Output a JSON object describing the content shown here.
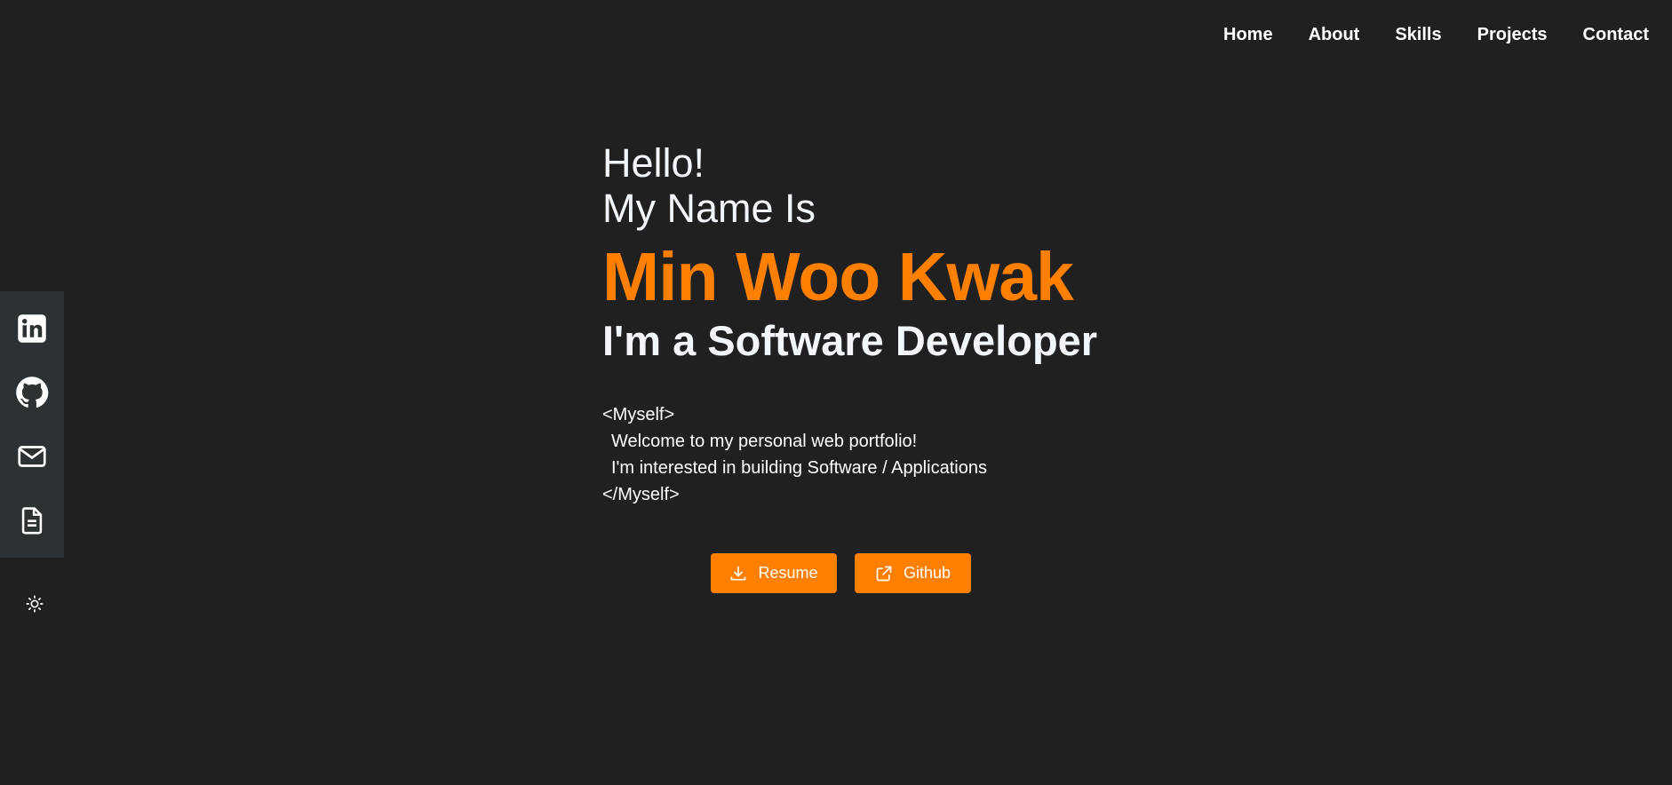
{
  "nav": {
    "items": [
      {
        "label": "Home"
      },
      {
        "label": "About"
      },
      {
        "label": "Skills"
      },
      {
        "label": "Projects"
      },
      {
        "label": "Contact"
      }
    ]
  },
  "social": {
    "icons": [
      "linkedin-icon",
      "github-icon",
      "mail-icon",
      "document-icon"
    ]
  },
  "theme_toggle_icon": "sun-icon",
  "hero": {
    "greeting_line1": "Hello!",
    "greeting_line2": "My Name Is",
    "name": "Min Woo Kwak",
    "role": "I'm a Software Developer",
    "about_open": "<Myself>",
    "about_line1": "Welcome to my personal web portfolio!",
    "about_line2": "I'm interested in building Software / Applications",
    "about_close": "</Myself>"
  },
  "buttons": {
    "resume_label": "Resume",
    "github_label": "Github"
  },
  "colors": {
    "background": "#202020",
    "accent": "#ff7f00",
    "sidebar": "#2c3134",
    "text": "#f2f5fa"
  }
}
